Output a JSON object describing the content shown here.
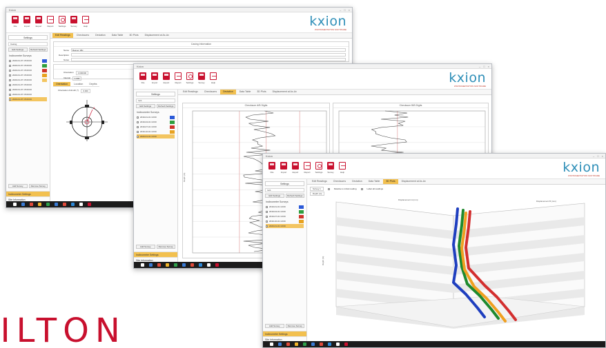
{
  "toolbar_labels": [
    "File",
    "Import",
    "Export",
    "Report",
    "Settings",
    "Survey",
    "Help"
  ],
  "toolbar_labels_short": [
    "File",
    "Import",
    "Export",
    "Report",
    "Settings",
    "Survey",
    "Help"
  ],
  "logo": {
    "text": "kxion",
    "tagline": "INSTRUMENTATION SOFTWARE"
  },
  "colors": {
    "brand_red": "#c8102e",
    "logo_blue": "#2f8fb8",
    "accent_yellow": "#f2c04f"
  },
  "window1": {
    "title": "Kxion",
    "sidebar": {
      "header": "Settings",
      "field": "Casing",
      "buttons": [
        "Edit Settings",
        "Refresh Settings"
      ],
      "list_title": "Inclinometer Surveys",
      "items": [
        "2020-01-07 15:00:00",
        "2020-01-07 15:00:00",
        "2020-01-07 15:00:00",
        "2020-01-07 15:00:00",
        "2020-01-07 15:00:00",
        "2020-01-07 15:00:00",
        "2020-01-07 15:00:00",
        "2020-01-07 15:00:00",
        "2020-01-07 15:00:00"
      ],
      "footer_buttons": [
        "Add Survey",
        "Remove Survey"
      ],
      "bottom": [
        "Inclinometer Settings",
        "Site Information",
        "Inclinometer Surveys"
      ]
    },
    "tabs": [
      "Edit Readings",
      "Checksums",
      "Deviation",
      "Data Table",
      "3D Plots",
      "Displacement at Ax-Ax"
    ],
    "form": {
      "section": "Casing Information",
      "rows": [
        {
          "label": "Name",
          "value": "Beaver 1Bx"
        },
        {
          "label": "Description",
          "value": ""
        },
        {
          "label": "Notes",
          "value": ""
        }
      ],
      "section2": "Casing Configuration",
      "rows2": [
        {
          "label": "Orientation",
          "value": "0.000000"
        },
        {
          "label": "Interval",
          "value": "1.000"
        }
      ]
    },
    "subtabs": [
      "Orientation",
      "Location",
      "Depths"
    ],
    "orientation": {
      "label": "Orientation Azimuth (°)",
      "value": "0.000"
    }
  },
  "window2": {
    "title": "Kxion",
    "sidebar": {
      "header": "Settings",
      "field": "Inc1",
      "buttons": [
        "Edit Settings",
        "Refresh Settings"
      ],
      "list_title": "Inclinometer Surveys",
      "items": [
        "2019-01-01 10:00",
        "2019-04-01 10:00",
        "2019-07-01 10:00",
        "2019-10-01 10:00",
        "2020-01-01 10:00"
      ],
      "footer_buttons": [
        "Add Survey",
        "Remove Survey"
      ],
      "bottom": [
        "Inclinometer Settings",
        "Site Information",
        "Inclinometer Surveys"
      ]
    },
    "tabs": [
      "Edit Readings",
      "Checksums",
      "Deviation",
      "Data Table",
      "3D Plots",
      "Displacement at Ax-Ax"
    ],
    "chart_left_title": "Checksum A/B Digits",
    "chart_right_title": "Checksum B/B Digits",
    "ylabel": "Depth (m)"
  },
  "window3": {
    "title": "Kxion",
    "sidebar": {
      "header": "Settings",
      "field": "Inc1",
      "buttons": [
        "Edit Settings",
        "Refresh Settings"
      ],
      "list_title": "Inclinometer Surveys",
      "items": [
        "2019-01-01 10:00",
        "2019-04-01 10:00",
        "2019-07-01 10:00",
        "2019-10-01 10:00",
        "2020-01-01 10:00"
      ],
      "footer_buttons": [
        "Add Survey",
        "Remove Survey"
      ],
      "bottom": [
        "Inclinometer Settings",
        "Site Information",
        "Inclinometer Surveys"
      ]
    },
    "tabs": [
      "Edit Readings",
      "Checksums",
      "Deviation",
      "Data Table",
      "3D Plots",
      "Displacement at Ax-Ax"
    ],
    "controls": {
      "check1": "Relative to initial reading",
      "check2": "Label all readings",
      "select": "Survey 1",
      "select2": "Depth (m)"
    },
    "axis_top": "Displacement A (mm)",
    "axis_right": "Displacement B (mm)",
    "ylabel": "Depth (m)",
    "series_colors": [
      "#1f3fbf",
      "#1e8a2e",
      "#d32f2f",
      "#f0a020"
    ]
  },
  "sidebar_colors": [
    "#2b5ad8",
    "#2e9f3e",
    "#d0352b",
    "#e8a21f",
    "#f3c560"
  ],
  "brand_text": "KILTON"
}
